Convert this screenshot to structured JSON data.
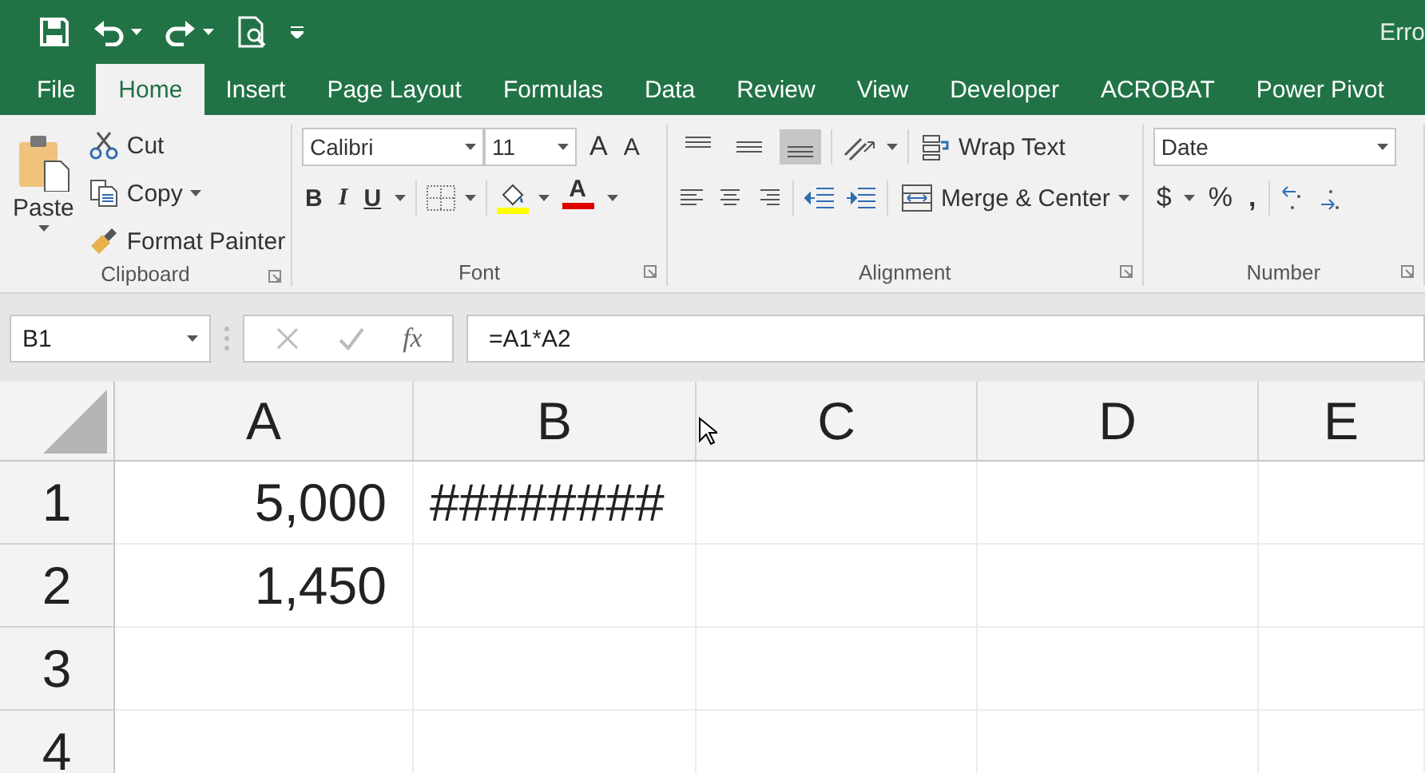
{
  "title_bar": {
    "title": "Erro"
  },
  "tabs": [
    {
      "label": "File",
      "selected": false
    },
    {
      "label": "Home",
      "selected": true
    },
    {
      "label": "Insert",
      "selected": false
    },
    {
      "label": "Page Layout",
      "selected": false
    },
    {
      "label": "Formulas",
      "selected": false
    },
    {
      "label": "Data",
      "selected": false
    },
    {
      "label": "Review",
      "selected": false
    },
    {
      "label": "View",
      "selected": false
    },
    {
      "label": "Developer",
      "selected": false
    },
    {
      "label": "ACROBAT",
      "selected": false
    },
    {
      "label": "Power Pivot",
      "selected": false
    }
  ],
  "clipboard": {
    "paste": "Paste",
    "cut": "Cut",
    "copy": "Copy",
    "format_painter": "Format Painter",
    "group": "Clipboard"
  },
  "font": {
    "name": "Calibri",
    "size": "11",
    "grow": "A",
    "shrink": "A",
    "bold": "B",
    "italic": "I",
    "underline": "U",
    "color_letter": "A",
    "group": "Font"
  },
  "alignment": {
    "vertical": [
      {
        "kind": "top",
        "selected": false
      },
      {
        "kind": "middle",
        "selected": false
      },
      {
        "kind": "bottom",
        "selected": true
      }
    ],
    "wrap": "Wrap Text",
    "merge": "Merge & Center",
    "group": "Alignment"
  },
  "number": {
    "format": "Date",
    "currency": "$",
    "percent": "%",
    "comma": ",",
    "group": "Number"
  },
  "formula_bar": {
    "name_box": "B1",
    "fx": "fx",
    "formula": "=A1*A2"
  },
  "grid": {
    "columns": [
      "A",
      "B",
      "C",
      "D",
      "E"
    ],
    "rows": [
      {
        "header": "1",
        "cells": [
          {
            "text": "5,000",
            "kind": "number"
          },
          {
            "text": "########",
            "kind": "overflow"
          }
        ]
      },
      {
        "header": "2",
        "cells": [
          {
            "text": "1,450",
            "kind": "number"
          }
        ]
      },
      {
        "header": "3"
      },
      {
        "header": "4"
      }
    ]
  }
}
